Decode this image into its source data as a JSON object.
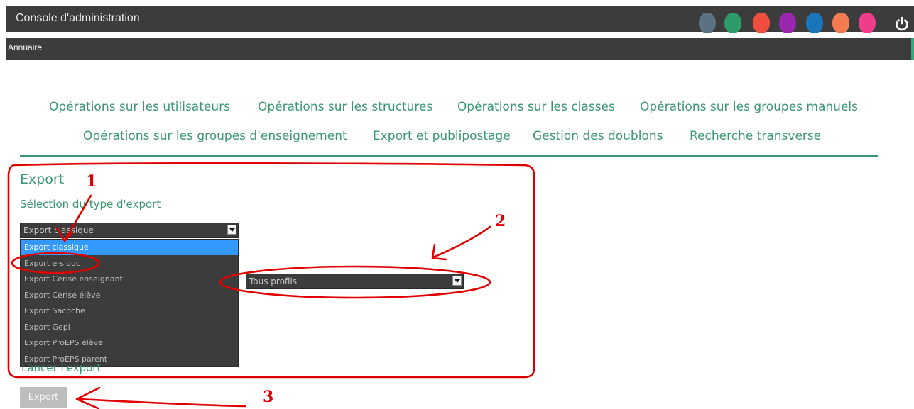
{
  "header": {
    "title": "Console d'administration",
    "app_dots": [
      "#5a7282",
      "#2e9b6a",
      "#f04e3e",
      "#9b27b0",
      "#1b75bb",
      "#f47b52",
      "#ef3d8c"
    ],
    "power_icon": "power-icon"
  },
  "subbar": {
    "label": "Annuaire"
  },
  "nav": {
    "items": [
      "Opérations sur les utilisateurs",
      "Opérations sur les structures",
      "Opérations sur les classes",
      "Opérations sur les groupes manuels",
      "Opérations sur les groupes d'enseignement",
      "Export et publipostage",
      "Gestion des doublons",
      "Recherche transverse"
    ]
  },
  "main": {
    "title": "Export",
    "subtitle": "Sélection du type d'export",
    "type_select": {
      "value": "Export classique"
    },
    "type_options": [
      "Export classique",
      "Export e-sidoc",
      "Export Cerise enseignant",
      "Export Cerise élève",
      "Export Sacoche",
      "Export Gepi",
      "Export ProEPS élève",
      "Export ProEPS parent"
    ],
    "profile_select": {
      "value": "Tous profils"
    },
    "launch_label": "Lancer l'export",
    "export_button": "Export"
  },
  "annotations": {
    "labels": [
      "1",
      "2",
      "3"
    ],
    "color": "#e00000"
  }
}
